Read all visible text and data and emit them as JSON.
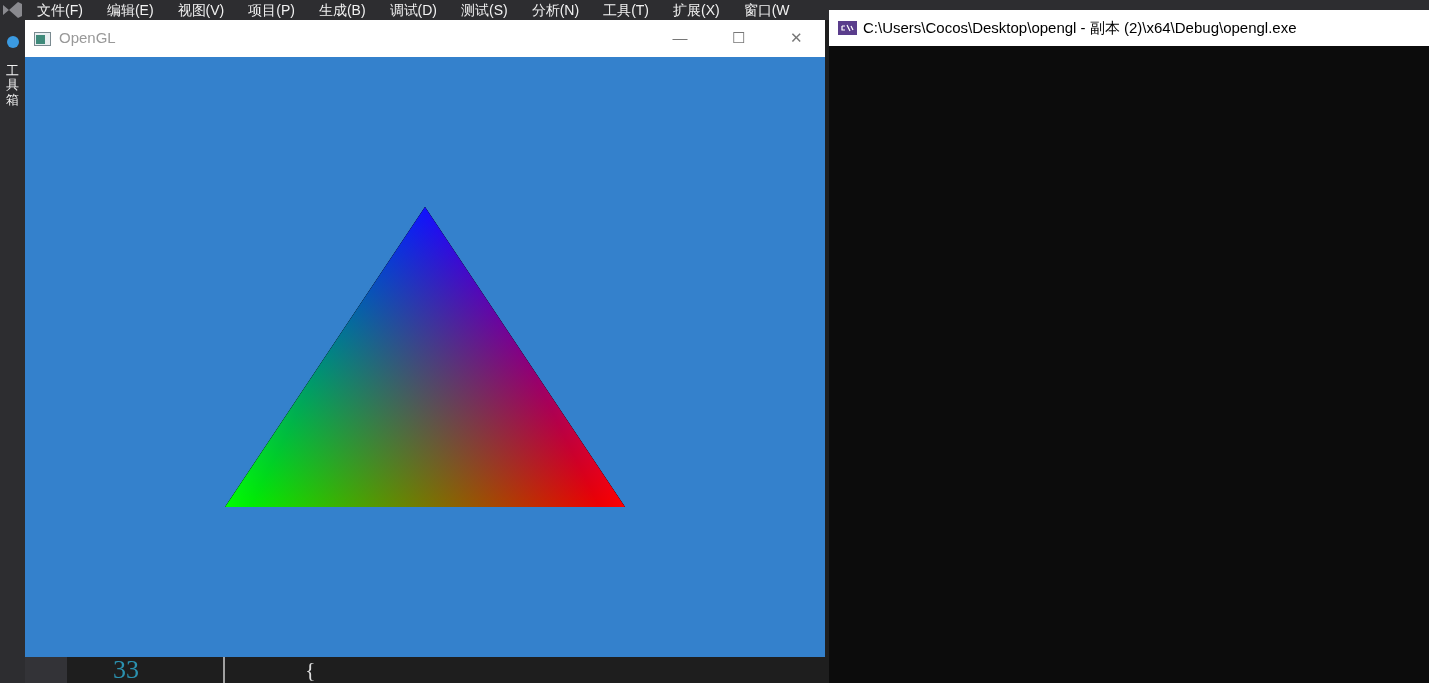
{
  "ide": {
    "menu": [
      "文件(F)",
      "编辑(E)",
      "视图(V)",
      "项目(P)",
      "生成(B)",
      "调试(D)",
      "测试(S)",
      "分析(N)",
      "工具(T)",
      "扩展(X)",
      "窗口(W"
    ],
    "side_panel": "工具箱",
    "editor": {
      "line_number": "33",
      "code": "{"
    }
  },
  "opengl_window": {
    "title": "OpenGL",
    "controls": [
      "—",
      "☐",
      "✕"
    ]
  },
  "console_window": {
    "title": "C:\\Users\\Cocos\\Desktop\\opengl - 副本 (2)\\x64\\Debug\\opengl.exe"
  }
}
